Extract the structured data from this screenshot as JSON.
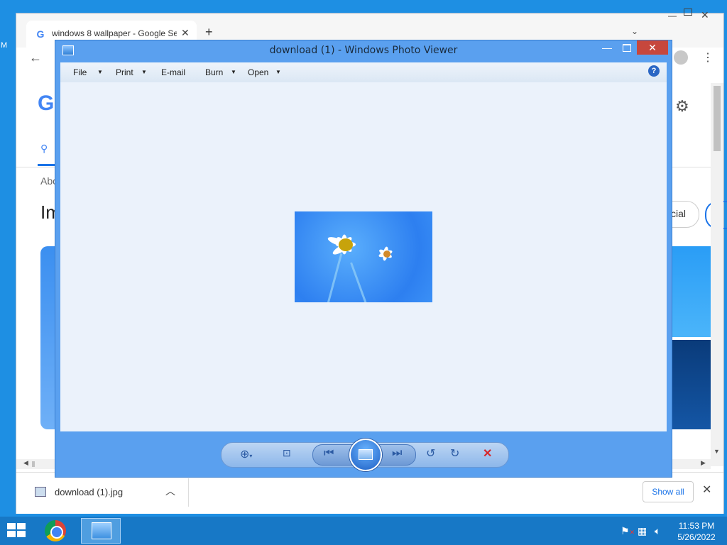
{
  "desktop": {
    "edge_letter": "M"
  },
  "chrome": {
    "tab_title": "windows 8 wallpaper - Google Se",
    "tab_favicon": "G",
    "new_tab_icon": "+",
    "back_icon": "←",
    "menu_icon": "⋮",
    "google_logo_fragment": "G",
    "about_fragment": "Abo",
    "heading_fragment": "Im",
    "chip_label": "cial",
    "download": {
      "file_name": "download (1).jpg",
      "show_all": "Show all"
    }
  },
  "photo_viewer": {
    "title": "download (1) - Windows Photo Viewer",
    "menu": {
      "file": "File",
      "print": "Print",
      "email": "E-mail",
      "burn": "Burn",
      "open": "Open"
    },
    "help": "?",
    "toolbar_icons": [
      "zoom-icon",
      "actual-size-icon",
      "previous-icon",
      "slideshow-icon",
      "next-icon",
      "rotate-left-icon",
      "rotate-right-icon",
      "delete-icon"
    ]
  },
  "taskbar": {
    "time": "11:53 PM",
    "date": "5/26/2022"
  },
  "colors": {
    "accent": "#1a73e8",
    "viewer_frame": "#5aa0ef",
    "taskbar": "#1778c6",
    "close_red": "#c7473d"
  }
}
